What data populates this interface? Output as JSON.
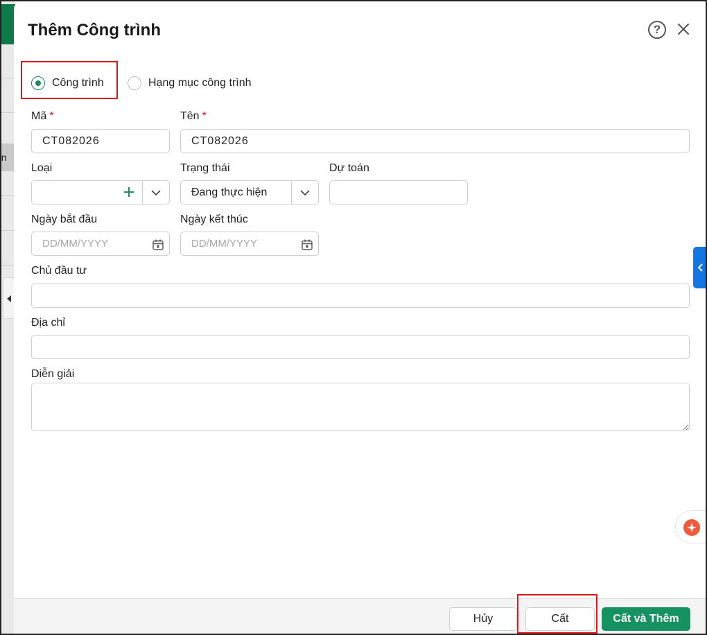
{
  "dialog": {
    "title": "Thêm Công trình"
  },
  "type_options": [
    {
      "label": "Công trình",
      "checked": true
    },
    {
      "label": "Hạng mục công trình",
      "checked": false
    }
  ],
  "fields": {
    "code": {
      "label": "Mã",
      "required_mark": "*",
      "value": "CT082026"
    },
    "name": {
      "label": "Tên",
      "required_mark": "*",
      "value": "CT082026"
    },
    "category": {
      "label": "Loại",
      "value": ""
    },
    "status": {
      "label": "Trạng thái",
      "value": "Đang thực hiện"
    },
    "estimate": {
      "label": "Dự toán",
      "value": ""
    },
    "start_date": {
      "label": "Ngày bắt đầu",
      "placeholder": "DD/MM/YYYY"
    },
    "end_date": {
      "label": "Ngày kết thúc",
      "placeholder": "DD/MM/YYYY"
    },
    "investor": {
      "label": "Chủ đầu tư",
      "value": ""
    },
    "address": {
      "label": "Địa chỉ",
      "value": ""
    },
    "description": {
      "label": "Diễn giải",
      "value": ""
    }
  },
  "footer": {
    "cancel_label": "Hủy",
    "save_label": "Cất",
    "save_add_label": "Cất và Thêm"
  },
  "background": {
    "cell_text": "ôn"
  },
  "colors": {
    "accent": "#169162",
    "highlight": "#e0151b",
    "side_tab": "#1476e0",
    "required": "#e0151b"
  }
}
